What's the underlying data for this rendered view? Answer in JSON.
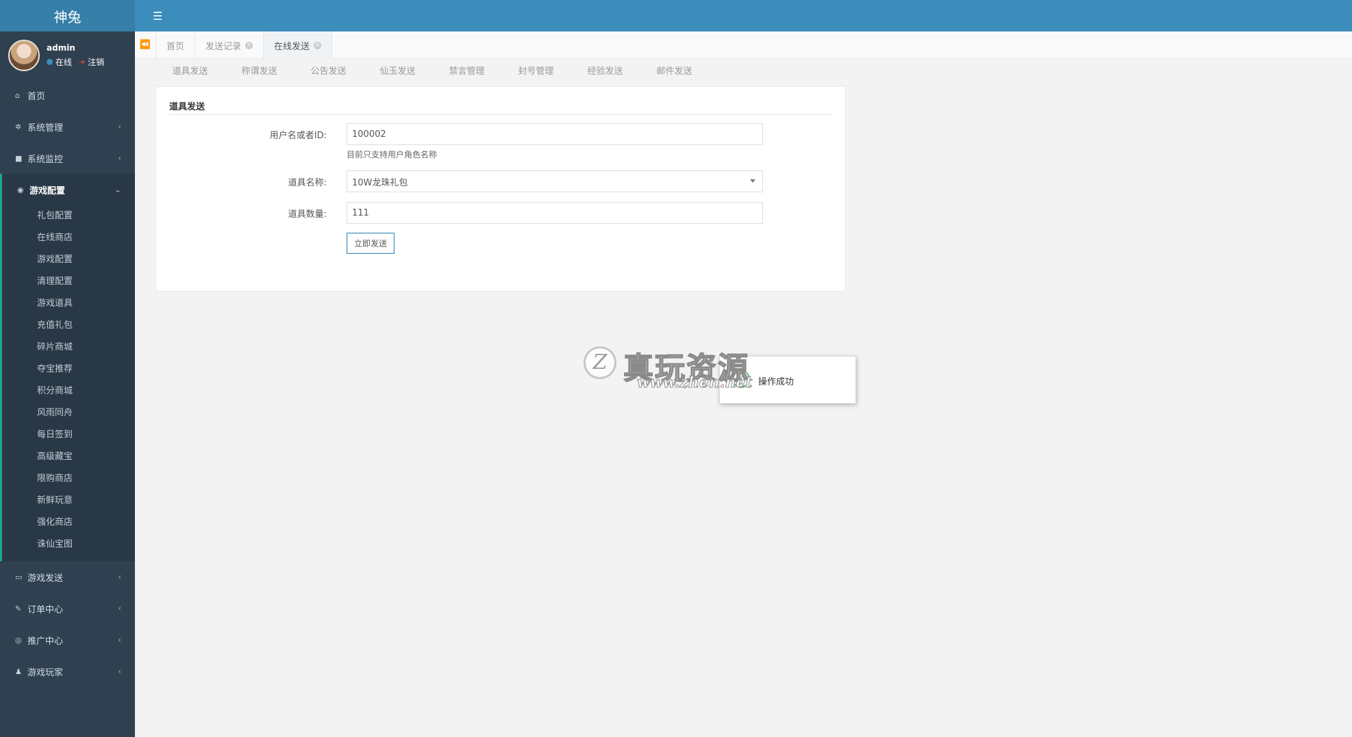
{
  "app": {
    "brand": "神兔"
  },
  "user": {
    "name": "admin",
    "status": "在线",
    "logout": "注销"
  },
  "sidebar": {
    "items": [
      {
        "label": "首页",
        "icon": "home-icon"
      },
      {
        "label": "系统管理",
        "icon": "gear-icon"
      },
      {
        "label": "系统监控",
        "icon": "video-camera-icon"
      },
      {
        "label": "游戏配置",
        "icon": "gamepad-icon"
      }
    ],
    "submenu": [
      "礼包配置",
      "在线商店",
      "游戏配置",
      "清理配置",
      "游戏道具",
      "充值礼包",
      "碎片商城",
      "夺宝推荐",
      "积分商城",
      "风雨同舟",
      "每日签到",
      "高级藏宝",
      "限购商店",
      "新鲜玩意",
      "强化商店",
      "诛仙宝图"
    ],
    "bottom_items": [
      {
        "label": "游戏发送",
        "icon": "keyboard-icon"
      },
      {
        "label": "订单中心",
        "icon": "brush-icon"
      },
      {
        "label": "推广中心",
        "icon": "handshake-icon"
      },
      {
        "label": "游戏玩家",
        "icon": "user-icon"
      }
    ]
  },
  "tabs": [
    {
      "label": "首页",
      "closable": false
    },
    {
      "label": "发送记录",
      "closable": true
    },
    {
      "label": "在线发送",
      "closable": true
    }
  ],
  "subnav": [
    "道具发送",
    "称谓发送",
    "公告发送",
    "仙玉发送",
    "禁言管理",
    "封号管理",
    "经验发送",
    "邮件发送"
  ],
  "form": {
    "title": "道具发送",
    "user_label": "用户名或者ID:",
    "user_value": "100002",
    "hint": "目前只支持用户角色名称",
    "item_label": "道具名称:",
    "item_value": "10W龙珠礼包",
    "qty_label": "道具数量:",
    "qty_value": "111",
    "submit": "立即发送"
  },
  "toast": {
    "message": "操作成功"
  },
  "watermark": {
    "title": "真玩资源",
    "url": "www.zhen.net",
    "badge": "Z"
  },
  "colors": {
    "sidebar": "#2f4050",
    "topbar": "#3c8dbc",
    "accent": "#19aa8d"
  }
}
